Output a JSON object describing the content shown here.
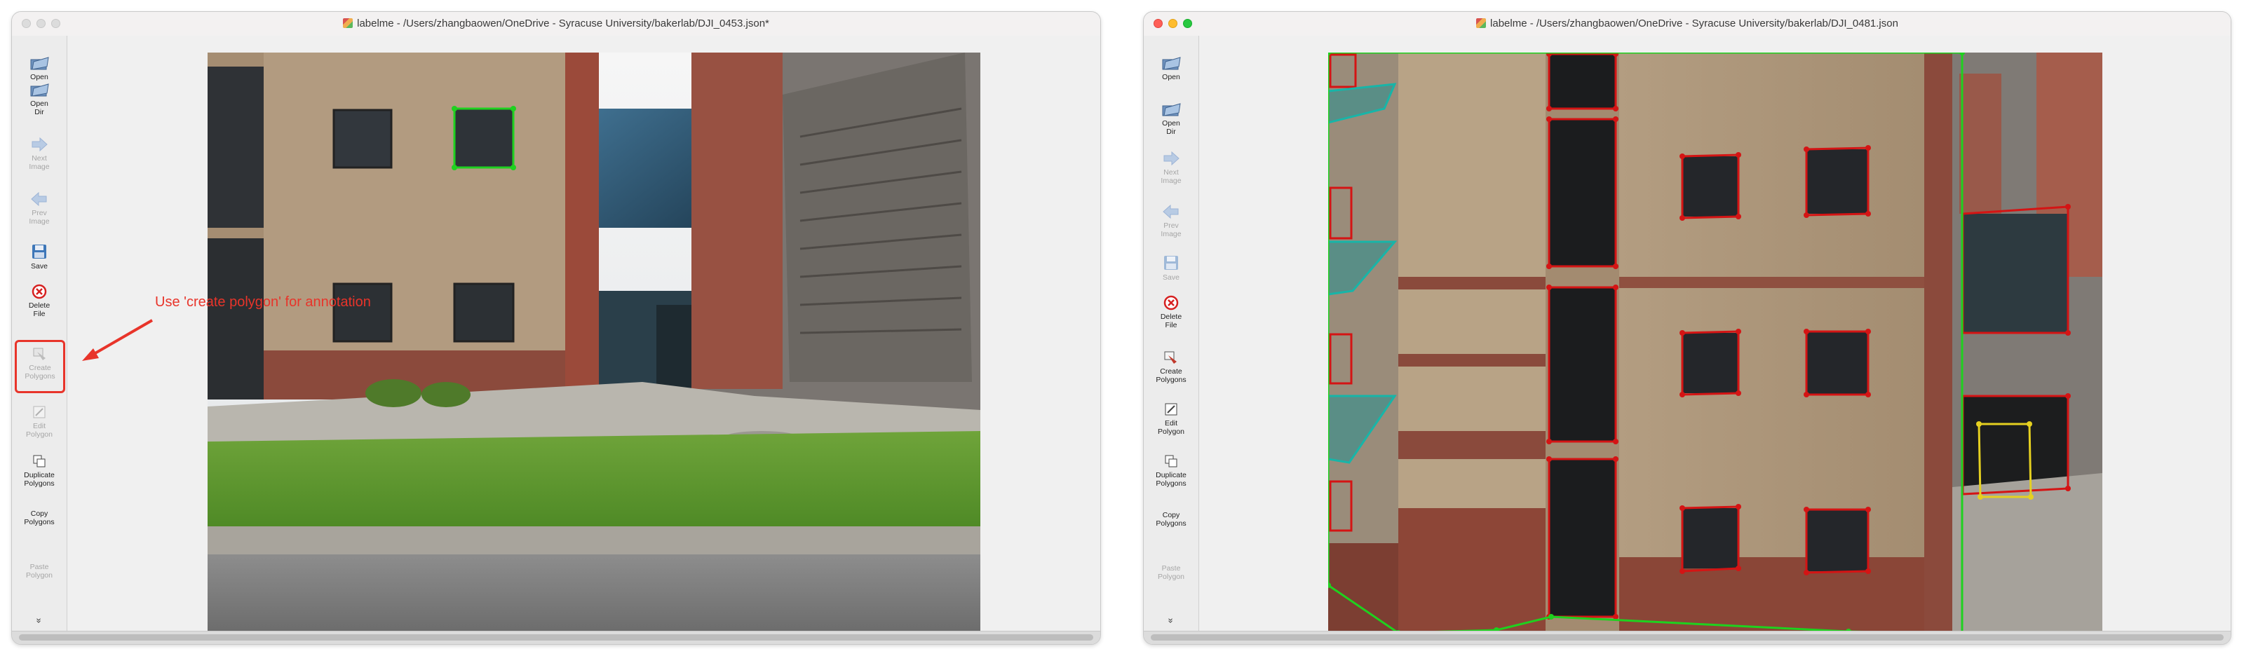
{
  "windows": [
    {
      "title": "labelme - /Users/zhangbaowen/OneDrive - Syracuse University/bakerlab/DJI_0453.json*",
      "traffic_lights_active": false,
      "annotation_text": "Use 'create polygon' for annotation"
    },
    {
      "title": "labelme - /Users/zhangbaowen/OneDrive - Syracuse University/bakerlab/DJI_0481.json",
      "traffic_lights_active": true
    }
  ],
  "toolbar": {
    "open": "Open",
    "open_dir": "Open\nDir",
    "next_image": "Next\nImage",
    "prev_image": "Prev\nImage",
    "save": "Save",
    "delete_file": "Delete\nFile",
    "create_polygons": "Create\nPolygons",
    "edit_polygons": "Edit\nPolygon",
    "duplicate_polygons": "Duplicate\nPolygons",
    "copy_polygons": "Copy\nPolygons",
    "paste_polygons": "Paste\nPolygon",
    "more": "»"
  },
  "colors": {
    "accent_red": "#e8342a",
    "polygon_green": "#1fd11f",
    "polygon_red": "#d41414",
    "polygon_teal": "#17b5a8",
    "polygon_yellow": "#e5d020"
  },
  "icons": [
    "folder-open-icon",
    "folder-dir-icon",
    "arrow-right-icon",
    "arrow-left-icon",
    "save-icon",
    "delete-icon",
    "create-polygon-icon",
    "edit-polygon-icon",
    "duplicate-icon",
    "copy-icon",
    "paste-icon",
    "chevron-double-down-icon"
  ]
}
